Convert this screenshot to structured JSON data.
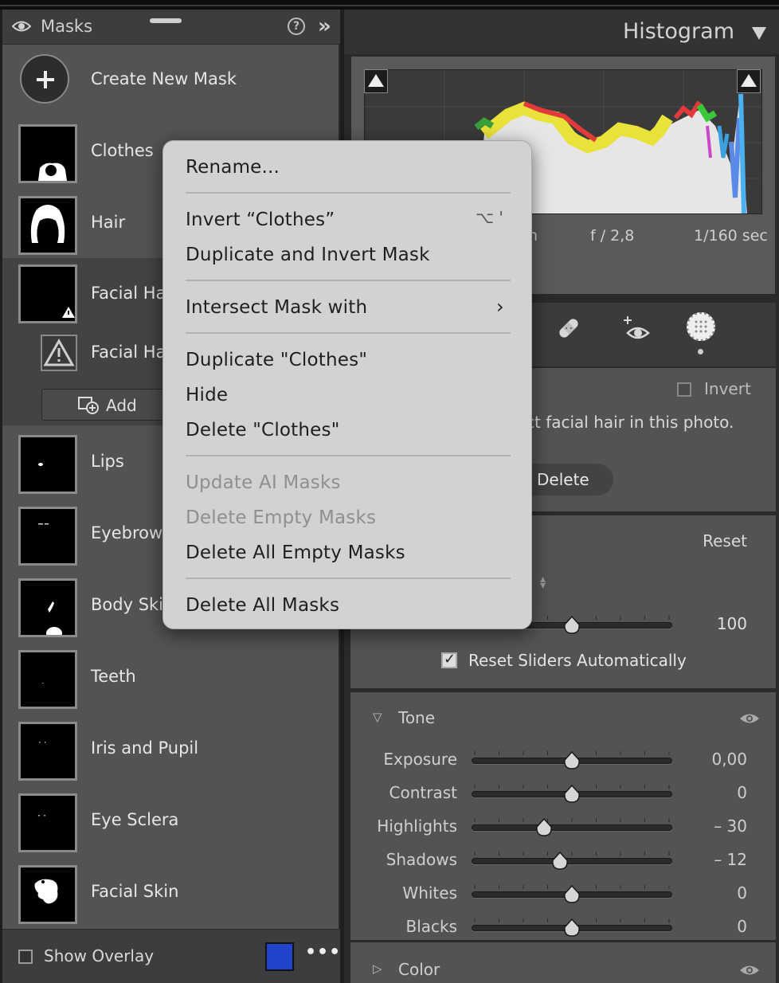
{
  "masks_panel": {
    "title": "Masks",
    "create_label": "Create New Mask",
    "items": [
      {
        "label": "Clothes"
      },
      {
        "label": "Hair"
      },
      {
        "label": "Facial Hai"
      },
      {
        "label": "Facial Ha"
      },
      {
        "label": "Lips"
      },
      {
        "label": "Eyebrows"
      },
      {
        "label": "Body Skir"
      },
      {
        "label": "Teeth"
      },
      {
        "label": "Iris and Pupil"
      },
      {
        "label": "Eye Sclera"
      },
      {
        "label": "Facial Skin"
      }
    ],
    "add_label": "Add",
    "show_overlay_label": "Show Overlay",
    "overlay_color": "#2244cc"
  },
  "histogram": {
    "title": "Histogram",
    "exif_partial": "n",
    "aperture": "f / 2,8",
    "shutter": "1/160 sec"
  },
  "mask_options": {
    "invert_label": "Invert",
    "message": "ct facial hair in this photo.",
    "delete_label": "Delete"
  },
  "amount": {
    "reset_label": "Reset",
    "value": "100",
    "value_fraction": 0.5,
    "reset_sliders_label": "Reset Sliders Automatically"
  },
  "tone": {
    "title": "Tone",
    "sliders": [
      {
        "name": "Exposure",
        "value": "0,00",
        "pos": 0.5
      },
      {
        "name": "Contrast",
        "value": "0",
        "pos": 0.5
      },
      {
        "name": "Highlights",
        "value": "– 30",
        "pos": 0.36
      },
      {
        "name": "Shadows",
        "value": "– 12",
        "pos": 0.44
      },
      {
        "name": "Whites",
        "value": "0",
        "pos": 0.5
      },
      {
        "name": "Blacks",
        "value": "0",
        "pos": 0.5
      }
    ]
  },
  "color_section": {
    "title": "Color"
  },
  "context_menu": {
    "rename": "Rename...",
    "invert": "Invert “Clothes”",
    "invert_shortcut": "⌥ '",
    "duplicate_invert": "Duplicate and Invert Mask",
    "intersect": "Intersect Mask with",
    "duplicate": "Duplicate \"Clothes\"",
    "hide": "Hide",
    "delete": "Delete \"Clothes\"",
    "update_ai": "Update AI Masks",
    "delete_empty": "Delete Empty Masks",
    "delete_all_empty": "Delete All Empty Masks",
    "delete_all": "Delete All Masks"
  },
  "colors": {
    "panel_bg": "#535353",
    "menu_bg": "#d2d2d2",
    "accent_overlay": "#2244cc"
  }
}
